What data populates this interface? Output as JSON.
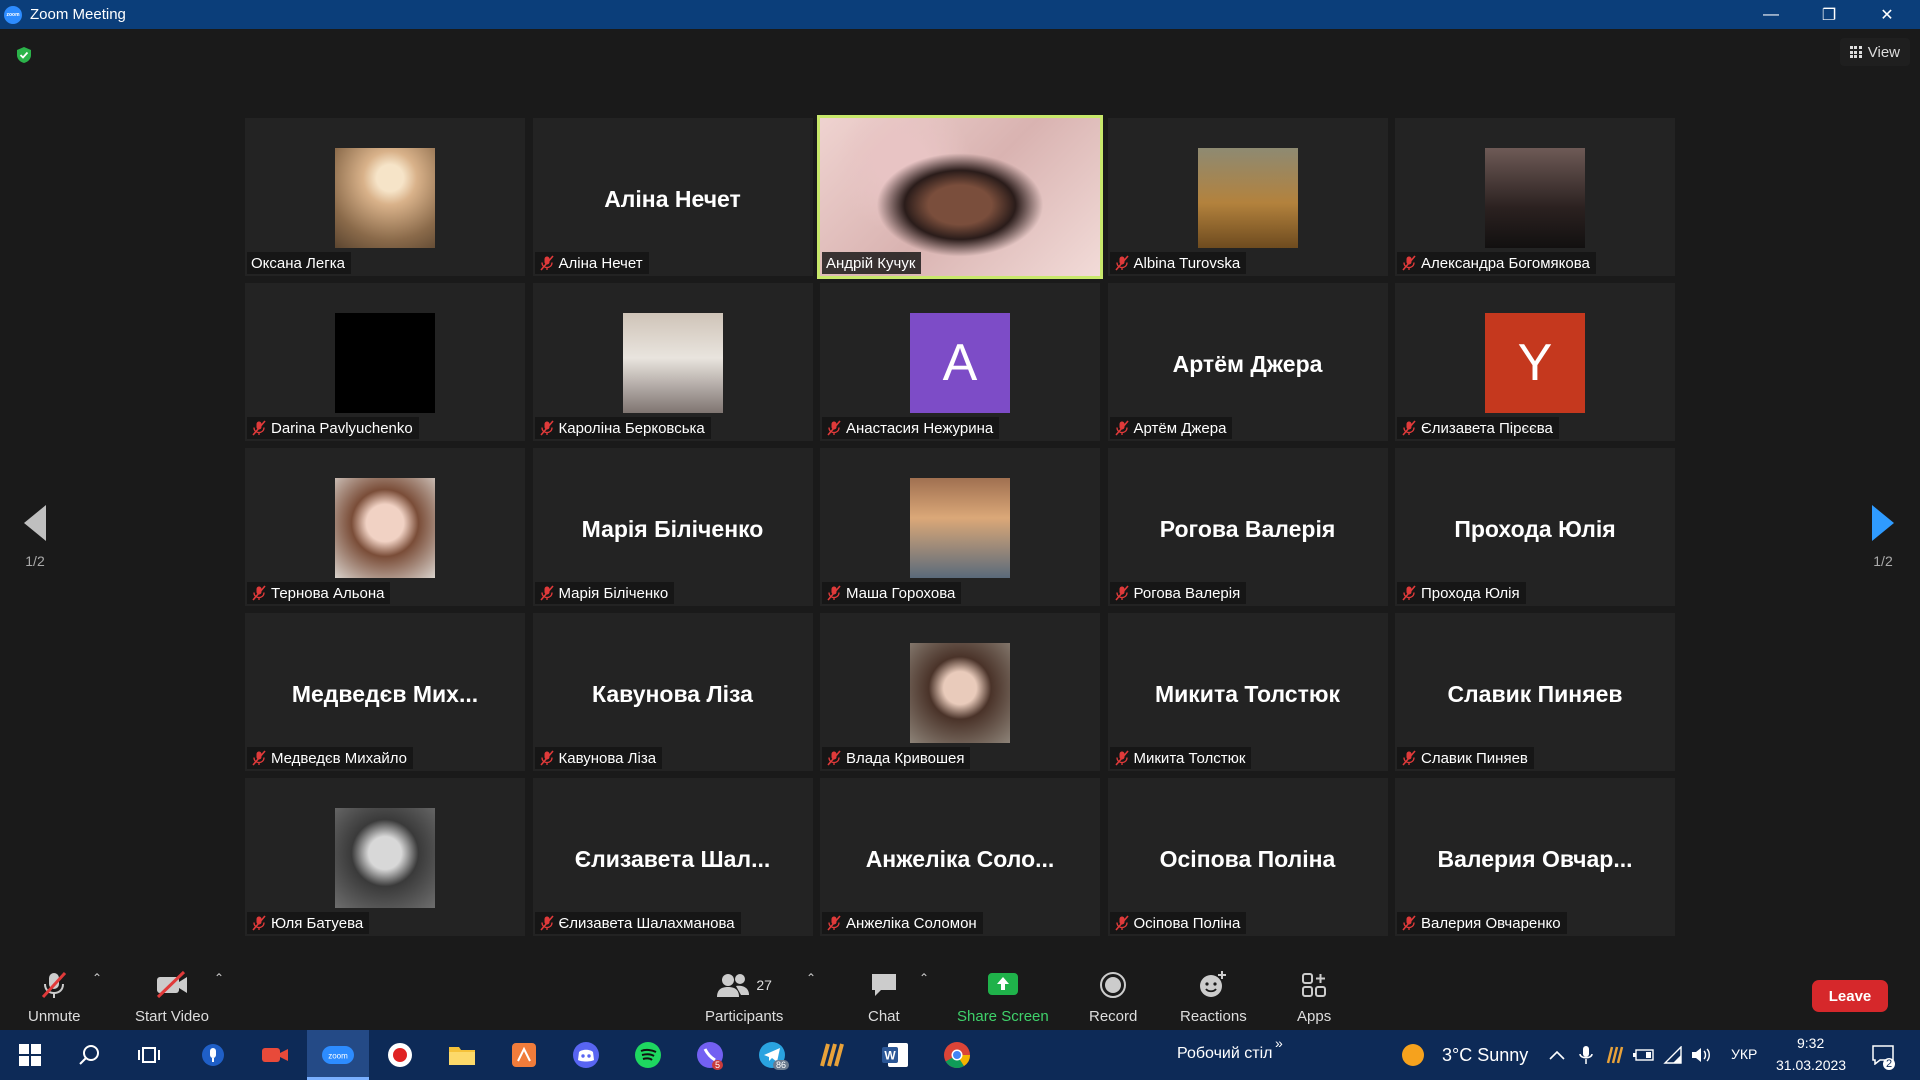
{
  "window": {
    "title": "Zoom Meeting",
    "minimize": "—",
    "restore": "❐",
    "close": "✕"
  },
  "meeting": {
    "view_label": "View",
    "page_indicator_left": "1/2",
    "page_indicator_right": "1/2"
  },
  "colors": {
    "titlebar": "#0b3e7a",
    "active_speaker": "#c8e86b",
    "leave": "#d6282b",
    "taskbar": "#0d2a57",
    "share": "#1fb24a"
  },
  "tiles": [
    {
      "name": "Оксана Легка",
      "display": "photo",
      "muted": false,
      "photo_icon": "woman-photo"
    },
    {
      "name": "Аліна Нечет",
      "display": "name",
      "big": "Аліна Нечет",
      "muted": true
    },
    {
      "name": "Андрій Кучук",
      "display": "video",
      "muted": false,
      "active": true
    },
    {
      "name": "Albina Turovska",
      "display": "photo",
      "muted": true,
      "photo_icon": "autumn-photo"
    },
    {
      "name": "Александра Богомякова",
      "display": "photo",
      "muted": true,
      "photo_icon": "hooded-photo"
    },
    {
      "name": "Darina Pavlyuchenko",
      "display": "photo",
      "muted": true,
      "photo_icon": "black-photo"
    },
    {
      "name": "Кароліна Берковська",
      "display": "photo",
      "muted": true,
      "photo_icon": "sunglasses-photo"
    },
    {
      "name": "Анастасия Нежурина",
      "display": "letter",
      "letter": "A",
      "letter_color": "#7d4cc7",
      "muted": true
    },
    {
      "name": "Артём Джера",
      "display": "name",
      "big": "Артём Джера",
      "muted": true
    },
    {
      "name": "Єлизавета Пірєєва",
      "display": "letter",
      "letter": "Y",
      "letter_color": "#c5381e",
      "muted": true
    },
    {
      "name": "Тернова Альона",
      "display": "photo",
      "muted": true,
      "photo_icon": "girl-photo"
    },
    {
      "name": "Марія Біліченко",
      "display": "name",
      "big": "Марія Біліченко",
      "muted": true
    },
    {
      "name": "Маша Горохова",
      "display": "photo",
      "muted": true,
      "photo_icon": "cartoon-photo"
    },
    {
      "name": "Рогова Валерія",
      "display": "name",
      "big": "Рогова Валерія",
      "muted": true
    },
    {
      "name": "Прохода Юлія",
      "display": "name",
      "big": "Прохода Юлія",
      "muted": true
    },
    {
      "name": "Медведєв Михайло",
      "display": "name",
      "big": "Медведєв Мих...",
      "muted": true
    },
    {
      "name": "Кавунова Ліза",
      "display": "name",
      "big": "Кавунова Ліза",
      "muted": true
    },
    {
      "name": "Влада Кривошея",
      "display": "photo",
      "muted": true,
      "photo_icon": "portrait-photo"
    },
    {
      "name": "Микита Толстюк",
      "display": "name",
      "big": "Микита Толстюк",
      "muted": true
    },
    {
      "name": "Славик Пиняев",
      "display": "name",
      "big": "Славик Пиняев",
      "muted": true
    },
    {
      "name": "Юля Батуева",
      "display": "photo",
      "muted": true,
      "photo_icon": "bw-photo"
    },
    {
      "name": "Єлизавета Шалахманова",
      "display": "name",
      "big": "Єлизавета  Шал...",
      "muted": true
    },
    {
      "name": "Анжеліка Соломон",
      "display": "name",
      "big": "Анжеліка Соло...",
      "muted": true
    },
    {
      "name": "Осіпова Поліна",
      "display": "name",
      "big": "Осіпова Поліна",
      "muted": true
    },
    {
      "name": "Валерия Овчаренко",
      "display": "name",
      "big": "Валерия  Овчар...",
      "muted": true
    }
  ],
  "controls": {
    "unmute": "Unmute",
    "start_video": "Start Video",
    "participants": "Participants",
    "participants_count": "27",
    "chat": "Chat",
    "share_screen": "Share Screen",
    "record": "Record",
    "reactions": "Reactions",
    "apps": "Apps",
    "leave": "Leave"
  },
  "taskbar": {
    "desktop_label": "Робочий стіл",
    "chevron": "»",
    "weather": "3°C  Sunny",
    "language": "УКР",
    "time": "9:32",
    "date": "31.03.2023",
    "notifications": "2",
    "viber_badge": "5",
    "telegram_badge": "86"
  }
}
